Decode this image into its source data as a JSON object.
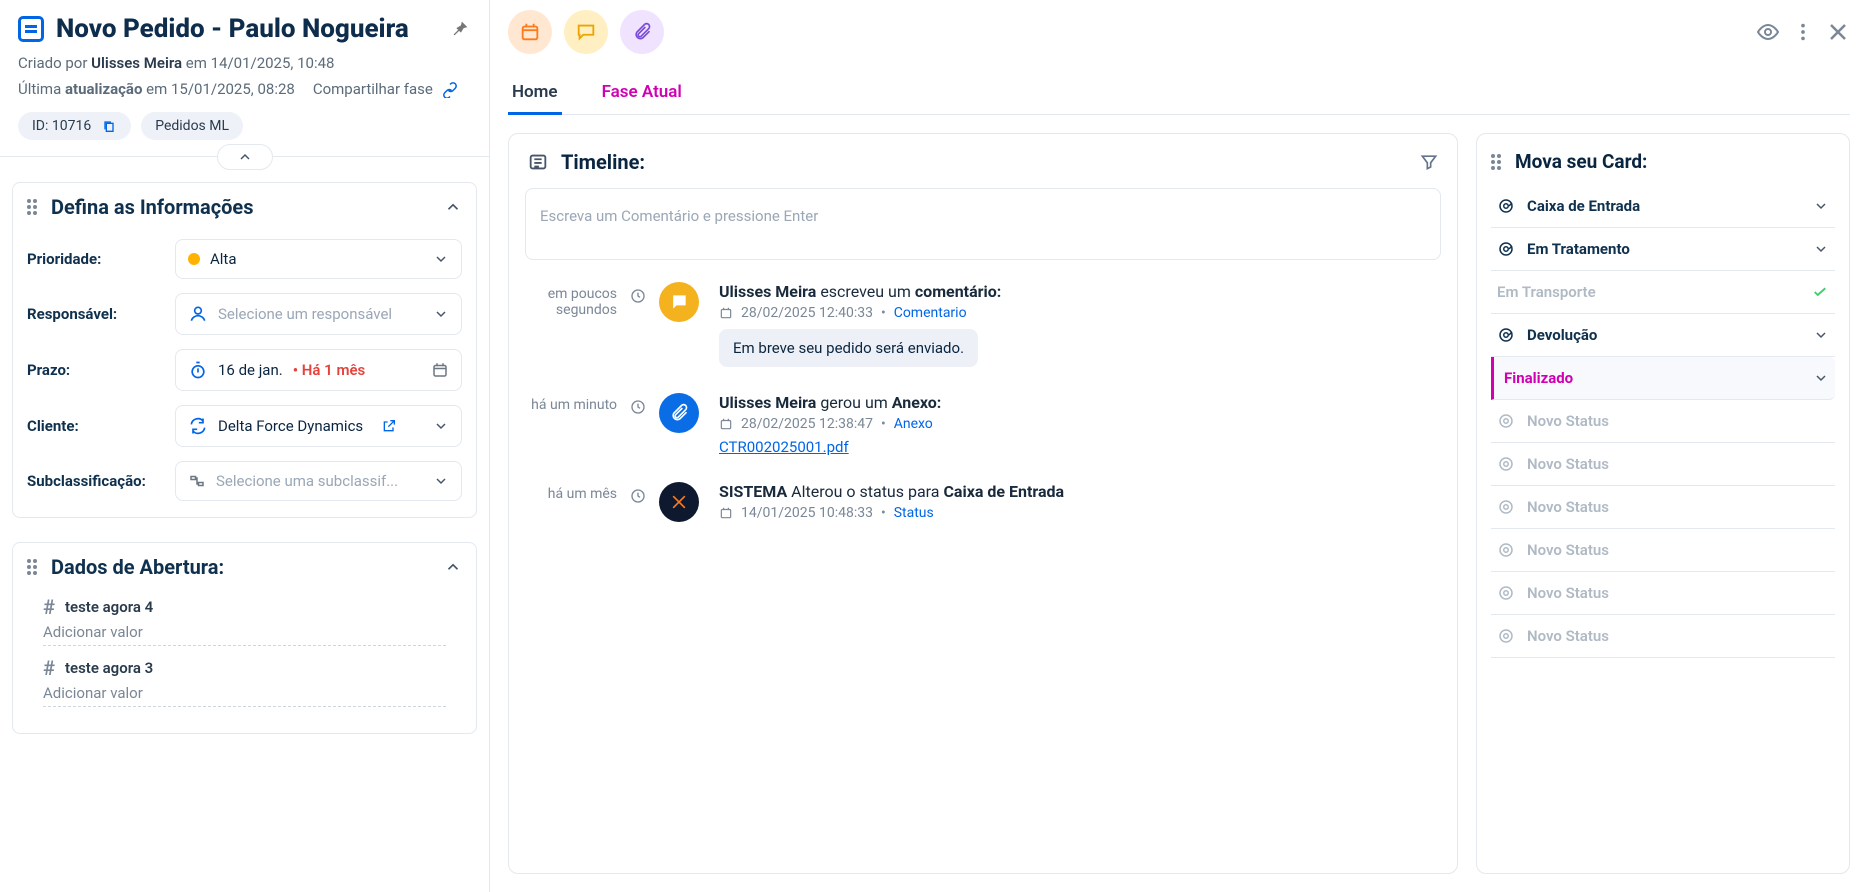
{
  "header": {
    "title": "Novo Pedido - Paulo Nogueira",
    "created_prefix": "Criado por ",
    "created_by": "Ulisses Meira",
    "created_on": " em 14/01/2025, 10:48",
    "updated_prefix": "Última ",
    "updated_word": "atualização",
    "updated_on": " em 15/01/2025, 08:28",
    "share_label": "Compartilhar fase",
    "chip_id": "ID: 10716",
    "chip_type": "Pedidos ML"
  },
  "info": {
    "title": "Defina as Informações",
    "rows": {
      "priority_label": "Prioridade:",
      "priority_value": "Alta",
      "responsible_label": "Responsável:",
      "responsible_placeholder": "Selecione um responsável",
      "deadline_label": "Prazo:",
      "deadline_value": "16 de jan.",
      "deadline_late": "• Há 1 mês",
      "client_label": "Cliente:",
      "client_value": "Delta Force Dynamics",
      "subclass_label": "Subclassificação:",
      "subclass_placeholder": "Selecione uma subclassif..."
    }
  },
  "open_data": {
    "title": "Dados de Abertura:",
    "field1": "teste agora 4",
    "field2": "teste agora 3",
    "add_value": "Adicionar valor"
  },
  "tabs": {
    "home": "Home",
    "current": "Fase Atual"
  },
  "timeline": {
    "title": "Timeline:",
    "comment_placeholder": "Escreva um Comentário e pressione Enter",
    "items": [
      {
        "when": "em poucos segundos",
        "author": "Ulisses Meira",
        "verb": " escreveu um ",
        "object": "comentário:",
        "ts": "28/02/2025 12:40:33",
        "tag": "Comentario",
        "bubble": "Em breve seu pedido será enviado."
      },
      {
        "when": "há um minuto",
        "author": "Ulisses Meira",
        "verb": " gerou um ",
        "object": "Anexo:",
        "ts": "28/02/2025 12:38:47",
        "tag": "Anexo",
        "link": "CTR002025001.pdf"
      },
      {
        "when": "há um mês",
        "author": "SISTEMA",
        "verb": " Alterou o status para ",
        "object": "Caixa de Entrada",
        "ts": "14/01/2025 10:48:33",
        "tag": "Status"
      }
    ]
  },
  "move": {
    "title": "Mova seu Card:",
    "phases": {
      "inbox": "Caixa de Entrada",
      "treatment": "Em Tratamento",
      "transport": "Em Transporte",
      "return": "Devolução",
      "finished": "Finalizado",
      "new_status": "Novo Status"
    }
  }
}
